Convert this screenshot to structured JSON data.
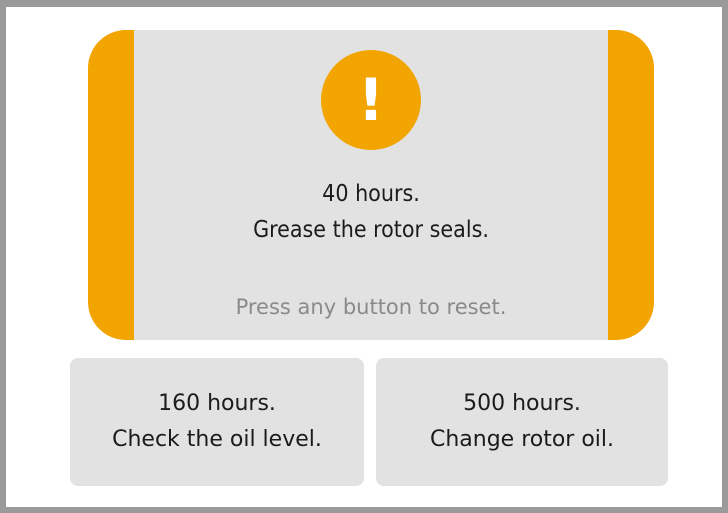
{
  "active_alert": {
    "icon": "exclamation-icon",
    "icon_glyph": "!",
    "interval": "40 hours.",
    "task": "Grease the rotor seals.",
    "hint": "Press any button to reset.",
    "accent_color": "#f2a400",
    "panel_color": "#e2e2e2"
  },
  "upcoming": [
    {
      "interval": "160 hours.",
      "task": "Check the oil level."
    },
    {
      "interval": "500 hours.",
      "task": "Change rotor oil."
    }
  ]
}
